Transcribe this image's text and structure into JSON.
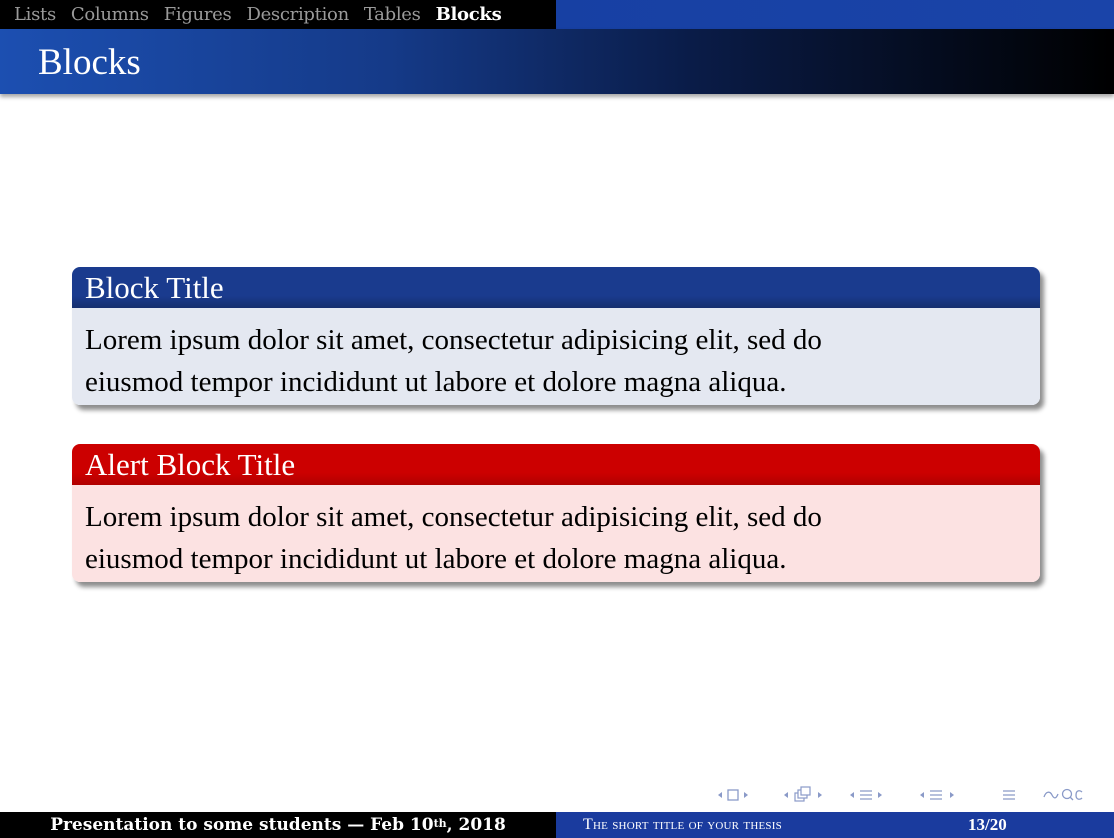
{
  "nav": {
    "sections": [
      "Lists",
      "Columns",
      "Figures",
      "Description",
      "Tables",
      "Blocks"
    ],
    "active": "Blocks"
  },
  "frame": {
    "title": "Blocks"
  },
  "blocks": [
    {
      "title": "Block Title",
      "body_line1": "Lorem ipsum dolor sit amet, consectetur adipisicing elit, sed do",
      "body_line2": "eiusmod tempor incididunt ut labore et dolore magna aliqua.",
      "type": "block",
      "head_color": "#1a3b8e",
      "body_color": "#e4e8f1"
    },
    {
      "title": "Alert Block Title",
      "body_line1": "Lorem ipsum dolor sit amet, consectetur adipisicing elit, sed do",
      "body_line2": "eiusmod tempor incididunt ut labore et dolore magna aliqua.",
      "type": "alertblock",
      "head_color": "#cc0000",
      "body_color": "#fce2e2"
    }
  ],
  "navigation_icons": [
    "slide-nav-icon",
    "frame-nav-icon",
    "subsection-nav-icon",
    "section-nav-icon",
    "align-icon",
    "search-icon"
  ],
  "footer": {
    "presentation": "Presentation to some students — Feb 10",
    "presentation_sup": "th",
    "presentation_year": ", 2018",
    "short_title": "The short title of your thesis",
    "page": "13/20"
  },
  "colors": {
    "nav_bg": "#000000",
    "title_bar_start": "#1c4fb1",
    "title_bar_end": "#000000",
    "footer_right_bg": "#1a3b9e"
  }
}
